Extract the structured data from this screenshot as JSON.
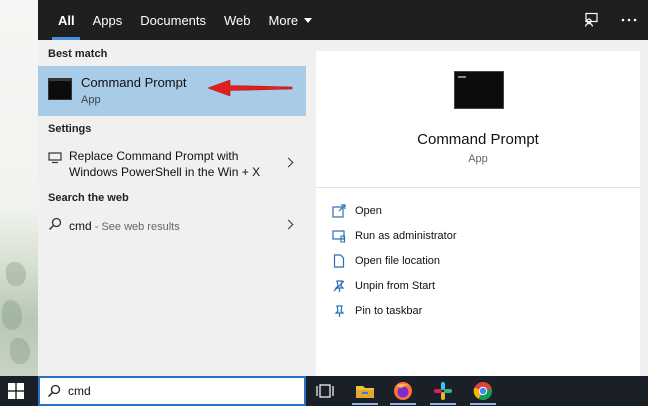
{
  "tabs": [
    {
      "label": "All",
      "active": true
    },
    {
      "label": "Apps"
    },
    {
      "label": "Documents"
    },
    {
      "label": "Web"
    },
    {
      "label": "More"
    }
  ],
  "top_icons": [
    "feedback-icon",
    "more-options-icon"
  ],
  "sections": {
    "best_match": "Best match",
    "settings": "Settings",
    "search_web": "Search the web"
  },
  "best_match_item": {
    "title": "Command Prompt",
    "subtitle": "App",
    "icon": "command-prompt-icon"
  },
  "settings_item": {
    "line1": "Replace Command Prompt with",
    "line2": "Windows PowerShell in the Win + X",
    "icon": "settings-display-icon"
  },
  "web_item": {
    "query": "cmd",
    "suffix": " - See web results",
    "icon": "search-icon"
  },
  "preview": {
    "title": "Command Prompt",
    "subtitle": "App"
  },
  "actions": [
    {
      "label": "Open",
      "icon": "open-icon"
    },
    {
      "label": "Run as administrator",
      "icon": "shield-icon"
    },
    {
      "label": "Open file location",
      "icon": "file-location-icon"
    },
    {
      "label": "Unpin from Start",
      "icon": "unpin-icon"
    },
    {
      "label": "Pin to taskbar",
      "icon": "pin-icon"
    }
  ],
  "search": {
    "value": "cmd"
  },
  "taskbar_icons": [
    "start-icon",
    "task-view-icon",
    "file-explorer-icon",
    "firefox-icon",
    "slack-icon",
    "chrome-icon"
  ],
  "colors": {
    "selection": "#a8cbe8",
    "accent": "#4a8fdd",
    "arrow": "#e0201e",
    "topbar": "#1f1f1f",
    "taskbar": "#1a1f28"
  }
}
